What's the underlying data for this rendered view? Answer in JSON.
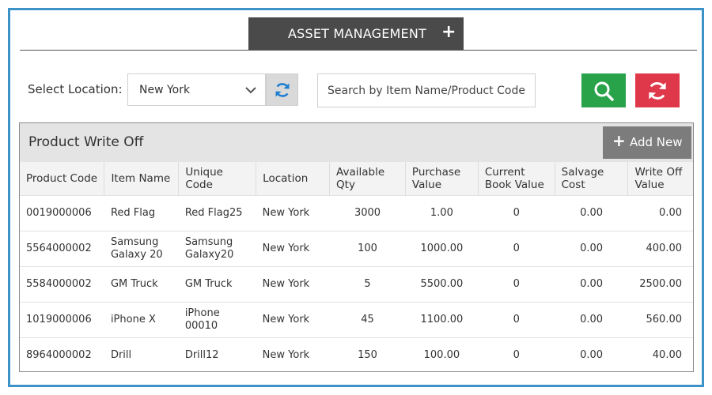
{
  "header": {
    "tab_label": "ASSET MANAGEMENT",
    "tab_plus": "+"
  },
  "filters": {
    "location_label": "Select Location:",
    "location_value": "New York",
    "search_placeholder": "Search by Item Name/Product Code"
  },
  "icons": {
    "chevron": "chevron-down-icon",
    "refresh": "refresh-icon",
    "search": "search-icon",
    "reset": "reset-icon"
  },
  "colors": {
    "frame": "#3d93c9",
    "tab": "#4a4a4a",
    "search_button": "#29a34a",
    "reset_button": "#e0384b",
    "add_button": "#7c7c7c",
    "refresh_icon": "#1f7fd0"
  },
  "panel": {
    "title": "Product Write Off",
    "add_plus": "+",
    "add_label": "Add New"
  },
  "table": {
    "columns": [
      "Product Code",
      "Item Name",
      "Unique Code",
      "Location",
      "Available Qty",
      "Purchase Value",
      "Current Book Value",
      "Salvage Cost",
      "Write Off Value"
    ],
    "rows": [
      [
        "0019000006",
        "Red Flag",
        "Red Flag25",
        "New York",
        "3000",
        "1.00",
        "0",
        "0.00",
        "0.00"
      ],
      [
        "5564000002",
        "Samsung Galaxy 20",
        "Samsung Galaxy20",
        "New York",
        "100",
        "1000.00",
        "0",
        "0.00",
        "400.00"
      ],
      [
        "5584000002",
        "GM Truck",
        "GM Truck",
        "New York",
        "5",
        "5500.00",
        "0",
        "0.00",
        "2500.00"
      ],
      [
        "1019000006",
        "iPhone X",
        "iPhone 00010",
        "New York",
        "45",
        "1100.00",
        "0",
        "0.00",
        "560.00"
      ],
      [
        "8964000002",
        "Drill",
        "Drill12",
        "New York",
        "150",
        "100.00",
        "0",
        "0.00",
        "40.00"
      ]
    ]
  }
}
